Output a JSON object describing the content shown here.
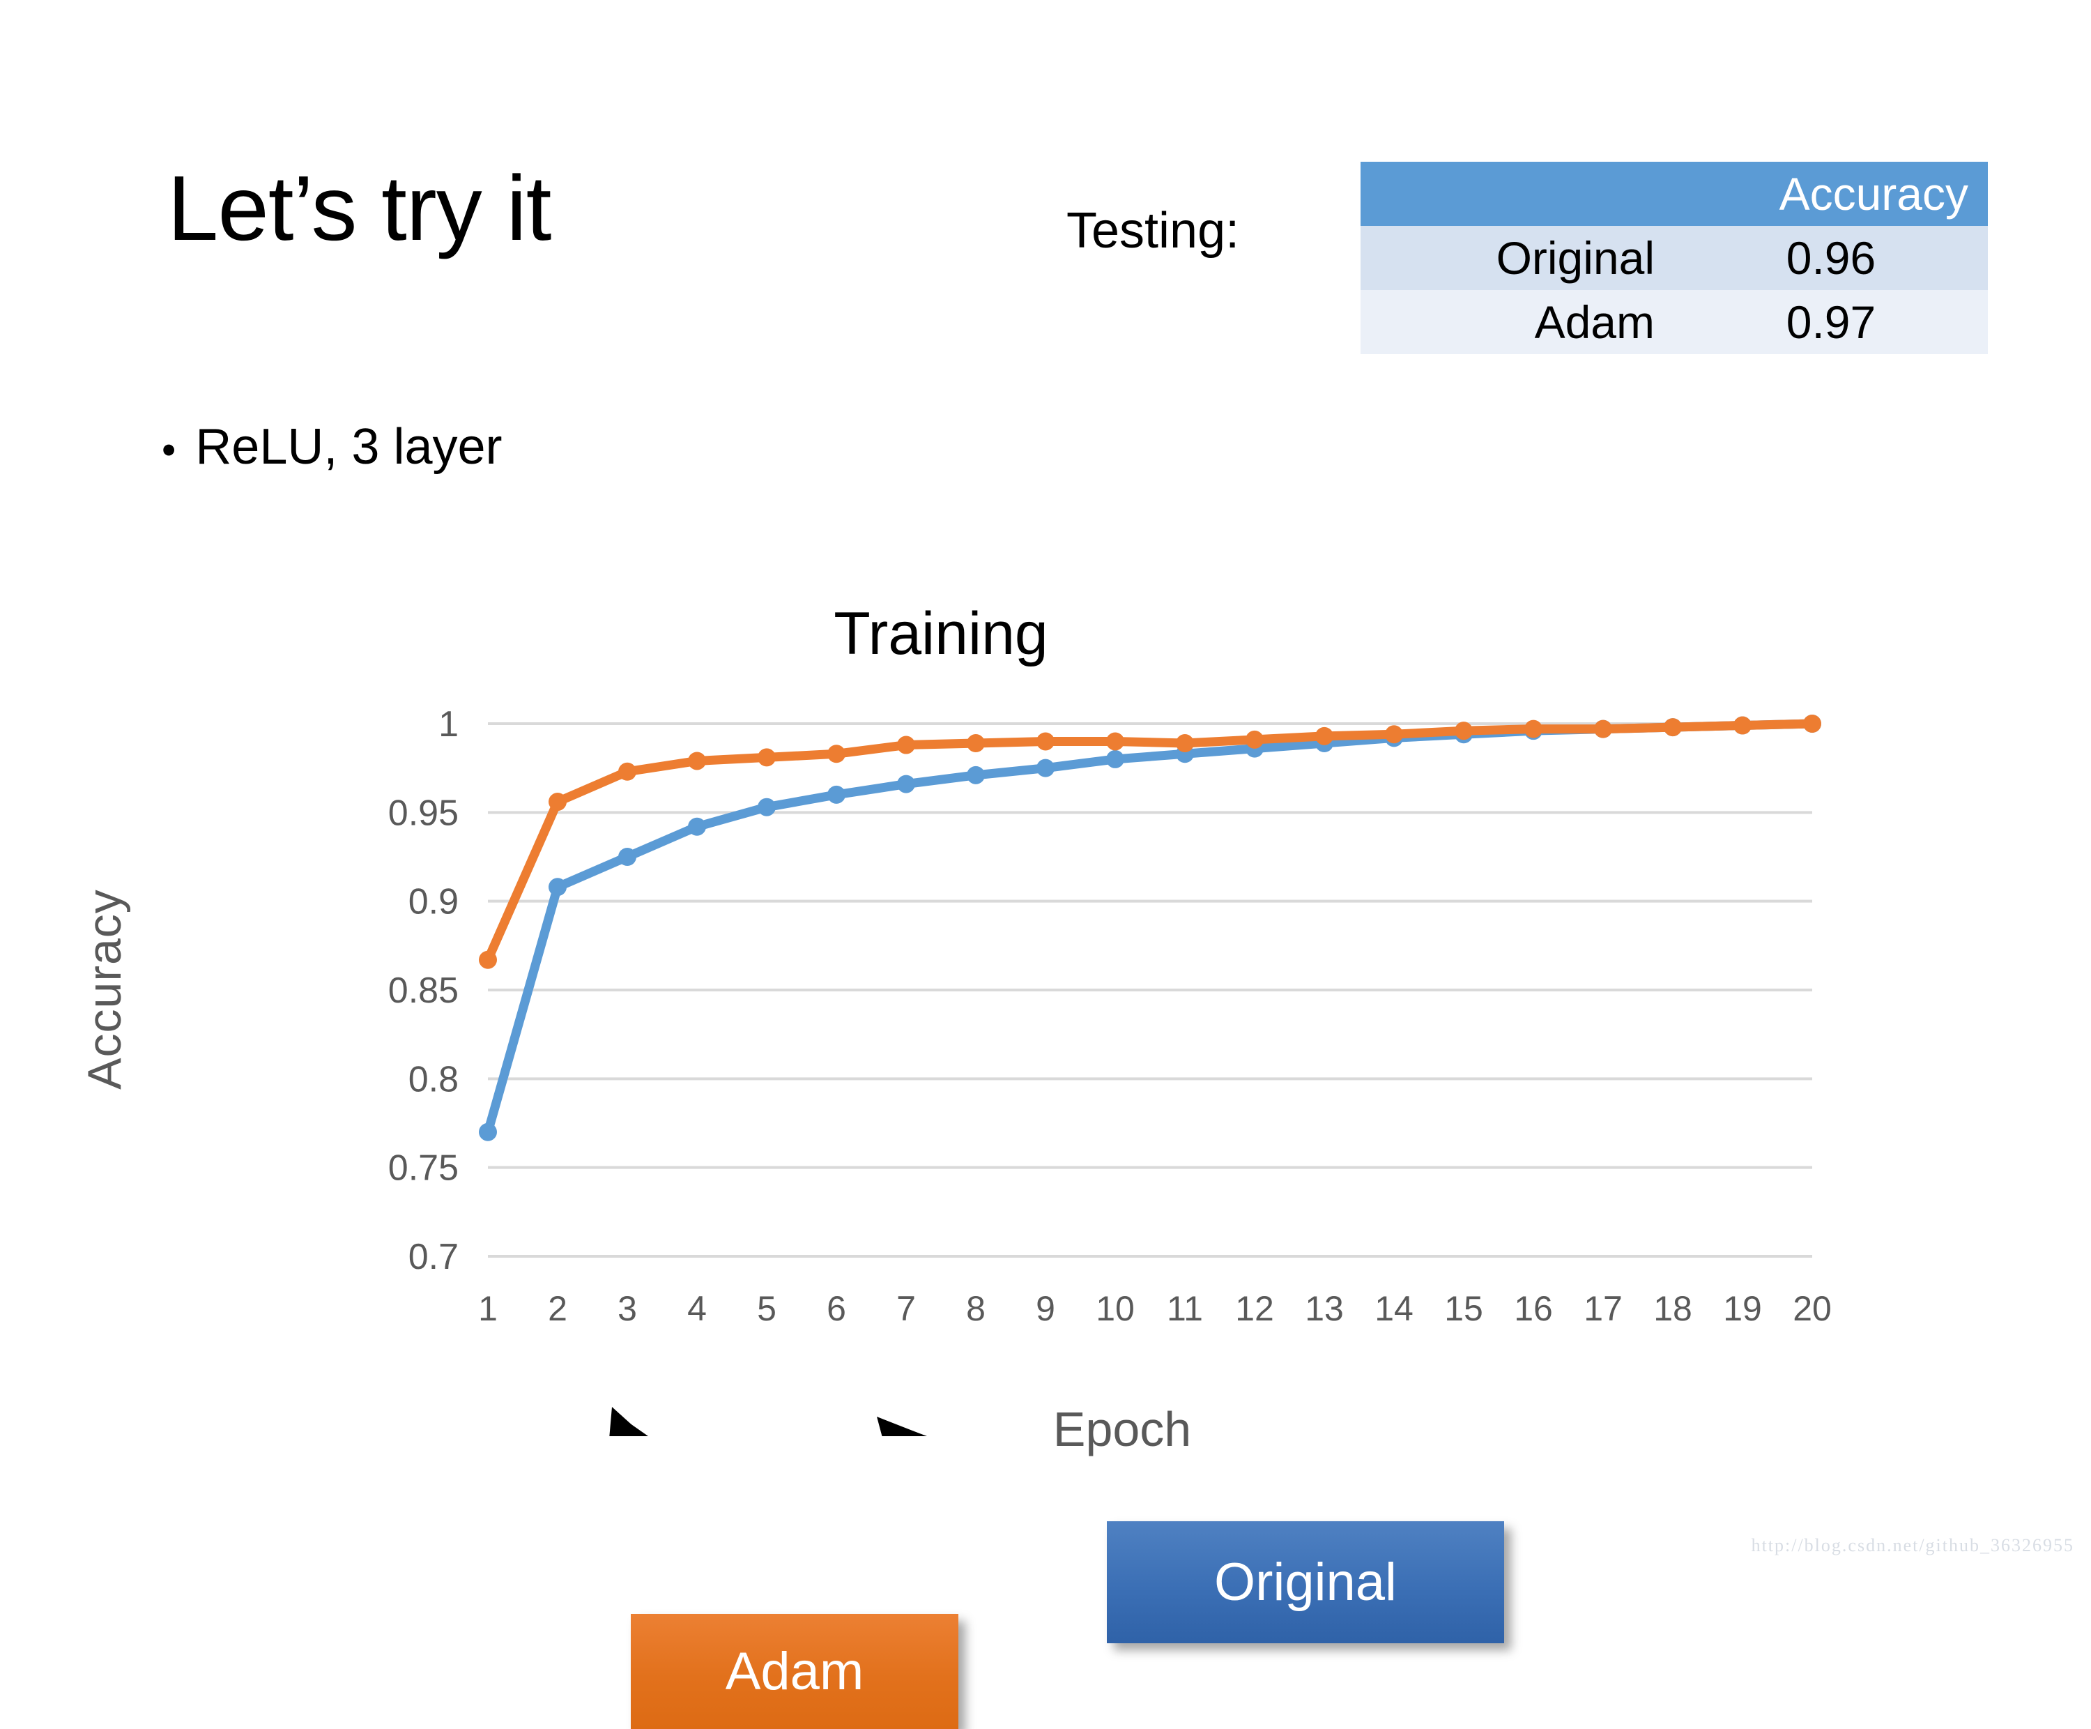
{
  "slide": {
    "title": "Let’s try it",
    "bullets": [
      "ReLU, 3 layer"
    ],
    "bullet_glyph": "•"
  },
  "testing": {
    "label": "Testing:",
    "table": {
      "headers": [
        "",
        "Accuracy"
      ],
      "rows": [
        {
          "name": "Original",
          "accuracy": "0.96"
        },
        {
          "name": "Adam",
          "accuracy": "0.97"
        }
      ]
    },
    "header_bg": "#5b9bd5",
    "row_bg_a": "#d6e1f0",
    "row_bg_b": "#ebf0f8"
  },
  "callouts": {
    "adam": {
      "label": "Adam",
      "color": "#e2711c"
    },
    "original": {
      "label": "Original",
      "color": "#3b6fb5"
    }
  },
  "watermark": "http://blog.csdn.net/github_36326955",
  "chart_data": {
    "type": "line",
    "title": "Training",
    "xlabel": "Epoch",
    "ylabel": "Accuracy",
    "x": [
      1,
      2,
      3,
      4,
      5,
      6,
      7,
      8,
      9,
      10,
      11,
      12,
      13,
      14,
      15,
      16,
      17,
      18,
      19,
      20
    ],
    "xticklabels": [
      "1",
      "2",
      "3",
      "4",
      "5",
      "6",
      "7",
      "8",
      "9",
      "10",
      "11",
      "12",
      "13",
      "14",
      "15",
      "16",
      "17",
      "18",
      "19",
      "20"
    ],
    "yticklabels": [
      "0.7",
      "0.75",
      "0.8",
      "0.85",
      "0.9",
      "0.95",
      "1"
    ],
    "yticks": [
      0.7,
      0.75,
      0.8,
      0.85,
      0.9,
      0.95,
      1
    ],
    "ylim": [
      0.7,
      1.0
    ],
    "xlim": [
      1,
      20
    ],
    "grid": "horizontal",
    "legend": "annotated-callouts",
    "series": [
      {
        "name": "Original",
        "color": "#5b9bd5",
        "marker": "circle",
        "values": [
          0.77,
          0.908,
          0.925,
          0.942,
          0.953,
          0.96,
          0.966,
          0.971,
          0.975,
          0.98,
          0.983,
          0.986,
          0.989,
          0.992,
          0.994,
          0.996,
          0.997,
          0.998,
          0.999,
          1.0
        ]
      },
      {
        "name": "Adam",
        "color": "#ed7d31",
        "marker": "circle",
        "values": [
          0.867,
          0.956,
          0.973,
          0.979,
          0.981,
          0.983,
          0.988,
          0.989,
          0.99,
          0.99,
          0.989,
          0.991,
          0.993,
          0.994,
          0.996,
          0.997,
          0.997,
          0.998,
          0.999,
          1.0
        ]
      }
    ],
    "annotations": [
      {
        "label": "Adam",
        "points_to_series": "Adam",
        "points_to_x": 3
      },
      {
        "label": "Original",
        "points_to_series": "Original",
        "points_to_x": 6
      }
    ]
  }
}
